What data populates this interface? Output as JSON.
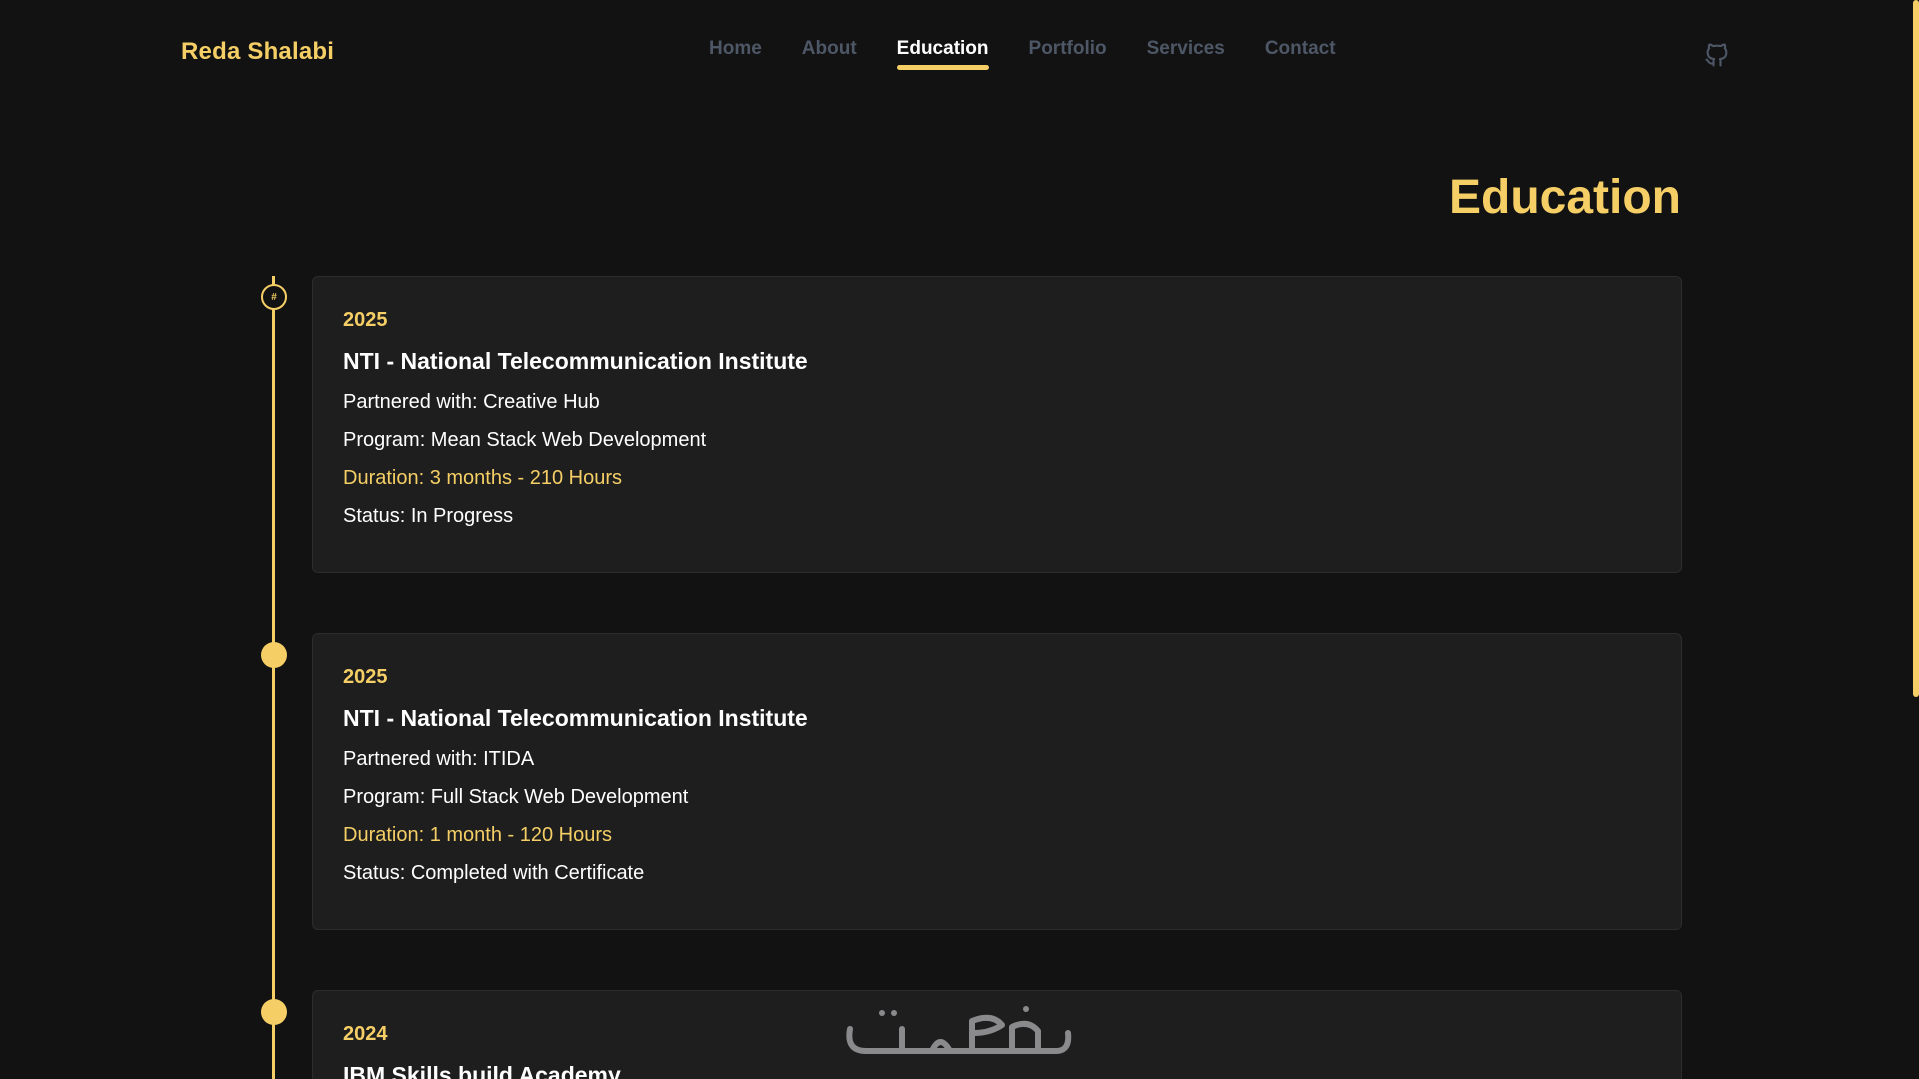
{
  "brand": "Reda Shalabi",
  "nav": {
    "items": [
      {
        "label": "Home",
        "active": false
      },
      {
        "label": "About",
        "active": false
      },
      {
        "label": "Education",
        "active": true
      },
      {
        "label": "Portfolio",
        "active": false
      },
      {
        "label": "Services",
        "active": false
      },
      {
        "label": "Contact",
        "active": false
      }
    ],
    "github_icon": "github-icon"
  },
  "section_title": "Education",
  "timeline_first_marker": "#",
  "education": [
    {
      "year": "2025",
      "institute": "NTI - National Telecommunication Institute",
      "partner": "Partnered with: Creative Hub",
      "program": "Program: Mean Stack Web Development",
      "duration": "Duration: 3 months - 210 Hours",
      "status": "Status: In Progress"
    },
    {
      "year": "2025",
      "institute": "NTI - National Telecommunication Institute",
      "partner": "Partnered with: ITIDA",
      "program": "Program: Full Stack Web Development",
      "duration": "Duration: 1 month - 120 Hours",
      "status": "Status: Completed with Certificate"
    },
    {
      "year": "2024",
      "institute": "IBM Skills build Academy"
    }
  ],
  "colors": {
    "accent": "#f5cf65",
    "background": "#121213",
    "card": "#1e1e1f",
    "nav_inactive": "#4e5766"
  }
}
